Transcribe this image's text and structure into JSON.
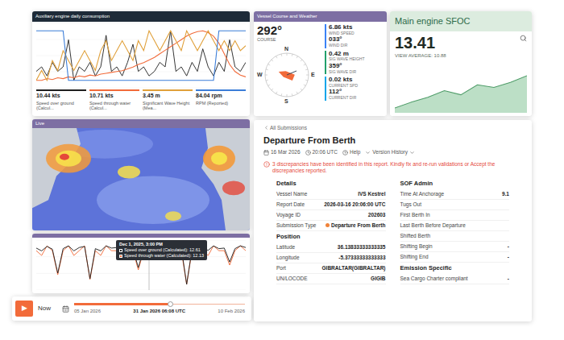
{
  "aux_chart": {
    "title": "Auxiliary engine daily consumption",
    "series": [
      {
        "value": "10.44 kts",
        "label": "Speed over ground (Calcul...",
        "color": "#1f1f1f",
        "values": [
          7,
          8,
          6,
          9,
          7,
          8,
          14,
          5,
          8,
          7,
          9,
          6,
          8,
          15,
          7,
          8,
          6,
          9,
          13,
          7,
          8,
          6,
          7,
          9,
          8,
          16,
          7,
          8,
          6,
          9,
          7,
          12,
          8,
          6,
          9,
          7,
          14,
          8,
          7,
          9
        ]
      },
      {
        "value": "10.71 kts",
        "label": "Speed through water (Calcul...",
        "color": "#f26b3a",
        "values": [
          9,
          9,
          9.2,
          9.1,
          9.3,
          9.2,
          9.4,
          9.3,
          9.5,
          9.4,
          9.6,
          9.5,
          9.7,
          9.8,
          9.9,
          10,
          10.1,
          10.3,
          10.5,
          10.8,
          11,
          11.3,
          11.6,
          12,
          12.4,
          12.8,
          13.2,
          13.6,
          14,
          14.3,
          14.5,
          14.6,
          14.4,
          14,
          13.2,
          12,
          10.8,
          10,
          9.6,
          9.4
        ]
      },
      {
        "value": "3.45 m",
        "label": "Significant Wave Height (Mea...",
        "color": "#e0a03a",
        "values": [
          3.1,
          3.2,
          3.1,
          3.3,
          3.2,
          3.4,
          3.3,
          3.2,
          3.3,
          3.4,
          3.3,
          3.2,
          3.4,
          3.5,
          3.3,
          3.4,
          3.5,
          3.4,
          3.3,
          3.5,
          3.4,
          3.6,
          3.5,
          3.4,
          3.5,
          3.6,
          3.5,
          3.4,
          3.6,
          3.5,
          3.4,
          3.5,
          3.6,
          3.5,
          3.4,
          3.5,
          3.4,
          3.5,
          3.4,
          3.45
        ]
      },
      {
        "value": "84.04 rpm",
        "label": "RPM (Reported)",
        "color": "#3b7dd8",
        "values": [
          88,
          88,
          88,
          88,
          88,
          88,
          60,
          60,
          60,
          60,
          60,
          60,
          60,
          60,
          60,
          60,
          60,
          60,
          60,
          60,
          60,
          60,
          60,
          60,
          60,
          60,
          60,
          60,
          60,
          60,
          60,
          60,
          60,
          60,
          88,
          88,
          88,
          88,
          88,
          88
        ]
      }
    ]
  },
  "vessel": {
    "title": "Vessel Course and Weather",
    "course": "292°",
    "course_label": "COURSE",
    "compass": [
      "N",
      "E",
      "S",
      "W"
    ],
    "groups": [
      {
        "color": "#3b82f6",
        "readings": [
          {
            "value": "6.86 kts",
            "label": "WIND SPEED"
          },
          {
            "value": "033°",
            "label": "WIND DIR"
          }
        ]
      },
      {
        "color": "#22a06b",
        "readings": [
          {
            "value": "0.42 m",
            "label": "SIG WAVE HEIGHT"
          },
          {
            "value": "359°",
            "label": "SIG WAVE DIR"
          }
        ]
      },
      {
        "color": "#0ea5e9",
        "readings": [
          {
            "value": "0.02 kts",
            "label": "CURRENT SPD"
          },
          {
            "value": "112°",
            "label": "CURRENT DIR"
          }
        ]
      }
    ]
  },
  "sfoc": {
    "title": "Main engine SFOC",
    "value": "13.41",
    "average": "VIEW AVERAGE: 10.88",
    "values": [
      9.5,
      10.2,
      10.8,
      11.6,
      11.1,
      12.3,
      12.0,
      12.6,
      13.41
    ]
  },
  "map": {
    "title": "Live"
  },
  "speed_chart": {
    "series": [
      {
        "color": "#f26b3a",
        "values": [
          12,
          11,
          13,
          12,
          7,
          12,
          13,
          11,
          12,
          13,
          6,
          12,
          11,
          13,
          12,
          12,
          11,
          13,
          12,
          8,
          12,
          13,
          11,
          12,
          13,
          12,
          11,
          12,
          5,
          12,
          13,
          12,
          11,
          13,
          12,
          12,
          9,
          12,
          13,
          12
        ]
      },
      {
        "color": "#1f1f1f",
        "values": [
          12.5,
          12,
          12.8,
          12.3,
          8,
          12.4,
          12.9,
          12,
          12.6,
          12.8,
          7,
          12.4,
          12,
          12.9,
          12.5,
          12.6,
          12.1,
          12.8,
          12.4,
          9,
          12.3,
          12.7,
          12.1,
          12.5,
          12.8,
          12.4,
          12,
          12.6,
          6,
          12.3,
          12.8,
          12.5,
          12.1,
          12.9,
          12.4,
          12.5,
          10,
          12.4,
          12.9,
          12.6
        ]
      }
    ],
    "tooltip": {
      "title": "Dec 1, 2025, 3:00 PM",
      "lines": [
        {
          "text": "Speed over ground (Calculated): 12.61",
          "color": "#1f1f1f"
        },
        {
          "text": "Speed through water (Calculated): 12.13",
          "color": "#f26b3a"
        }
      ]
    }
  },
  "timeline": {
    "play": "▶",
    "now": "Now",
    "start": "05 Jan 2026",
    "current": "31 Jan 2026 06:08 UTC",
    "end": "10 Feb 2026",
    "level": 0.56
  },
  "report": {
    "back": "All Submissions",
    "title": "Departure From Berth",
    "date": "16 Mar 2026",
    "time": "20:06 UTC",
    "help": "Help",
    "history": "Version History",
    "alert": "3 discrepancies have been identified in this report. Kindly fix and re-run validations or Accept the discrepancies reported.",
    "left": [
      {
        "title": "Details",
        "rows": [
          {
            "label": "Vessel Name",
            "value": "IVS Kestrel",
            "kind": "text"
          },
          {
            "label": "Report Date",
            "value": "2026-03-16 20:06:00 UTC",
            "kind": "text"
          },
          {
            "label": "Voyage ID",
            "value": "202603",
            "kind": "text"
          },
          {
            "label": "Submission Type",
            "value": "Departure From Berth",
            "kind": "status"
          }
        ]
      },
      {
        "title": "Position",
        "rows": [
          {
            "label": "Latitude",
            "value": "36.13833333333335",
            "kind": "text"
          },
          {
            "label": "Longitude",
            "value": "-5.37333333333333",
            "kind": "text"
          },
          {
            "label": "Port",
            "value": "GIBRALTAR(GIBRALTAR)",
            "kind": "text"
          },
          {
            "label": "UN/LOCODE",
            "value": "GIGIB",
            "kind": "text"
          }
        ]
      }
    ],
    "right": [
      {
        "title": "SOF Admin",
        "rows": [
          {
            "label": "Time At Anchorage",
            "value": "9.1",
            "kind": "text"
          },
          {
            "label": "Tugs Out",
            "value": "",
            "kind": "text"
          },
          {
            "label": "First Berth In",
            "value": "",
            "kind": "text"
          },
          {
            "label": "Last Berth Before Departure",
            "value": "",
            "kind": "text"
          },
          {
            "label": "Shifted Berth",
            "value": "",
            "kind": "text"
          },
          {
            "label": "Shifting Begin",
            "value": "-",
            "kind": "text"
          },
          {
            "label": "Shifting End",
            "value": "-",
            "kind": "text"
          }
        ]
      },
      {
        "title": "Emission Specific",
        "rows": [
          {
            "label": "Sea Cargo Charter compliant",
            "value": "-",
            "kind": "text"
          }
        ]
      }
    ]
  }
}
